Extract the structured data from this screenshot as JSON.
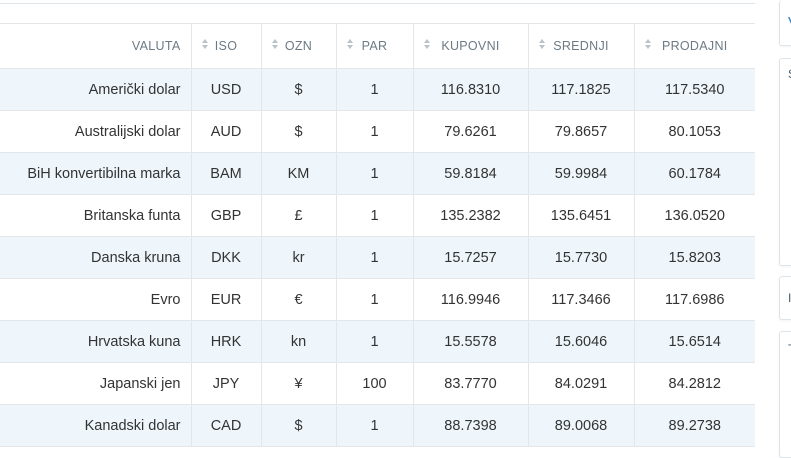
{
  "table": {
    "headers": [
      {
        "label": "VALUTA",
        "sortable": false
      },
      {
        "label": "ISO",
        "sortable": true
      },
      {
        "label": "OZN",
        "sortable": true
      },
      {
        "label": "PAR",
        "sortable": true
      },
      {
        "label": "KUPOVNI",
        "sortable": true
      },
      {
        "label": "SREDNJI",
        "sortable": true
      },
      {
        "label": "PRODAJNI",
        "sortable": true
      }
    ],
    "rows": [
      [
        "Američki dolar",
        "USD",
        "$",
        "1",
        "116.8310",
        "117.1825",
        "117.5340"
      ],
      [
        "Australijski dolar",
        "AUD",
        "$",
        "1",
        "79.6261",
        "79.8657",
        "80.1053"
      ],
      [
        "BiH konvertibilna marka",
        "BAM",
        "KM",
        "1",
        "59.8184",
        "59.9984",
        "60.1784"
      ],
      [
        "Britanska funta",
        "GBP",
        "£",
        "1",
        "135.2382",
        "135.6451",
        "136.0520"
      ],
      [
        "Danska kruna",
        "DKK",
        "kr",
        "1",
        "15.7257",
        "15.7730",
        "15.8203"
      ],
      [
        "Evro",
        "EUR",
        "€",
        "1",
        "116.9946",
        "117.3466",
        "117.6986"
      ],
      [
        "Hrvatska kuna",
        "HRK",
        "kn",
        "1",
        "15.5578",
        "15.6046",
        "15.6514"
      ],
      [
        "Japanski jen",
        "JPY",
        "¥",
        "100",
        "83.7770",
        "84.0291",
        "84.2812"
      ],
      [
        "Kanadski dolar",
        "CAD",
        "$",
        "1",
        "88.7398",
        "89.0068",
        "89.2738"
      ]
    ]
  },
  "sidebar": {
    "fragments": [
      "V",
      "S",
      "I",
      "T"
    ]
  },
  "colors": {
    "row_stripe": "#eef6fb",
    "header_text": "#6b7a85",
    "border": "#e3e7ea",
    "accent": "#2f7fc1"
  }
}
